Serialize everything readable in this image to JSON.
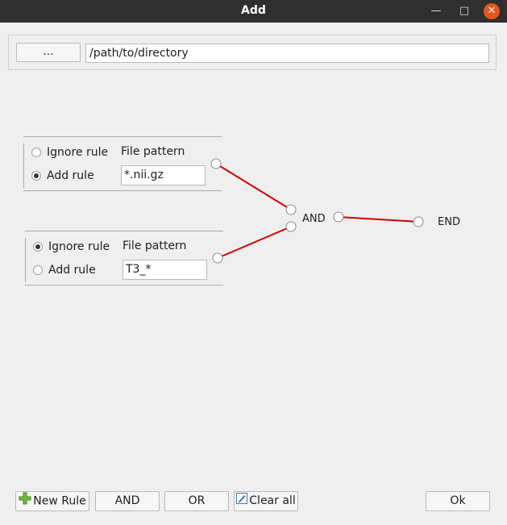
{
  "window": {
    "title": "Add"
  },
  "path": {
    "browse_label": "...",
    "value": "/path/to/directory"
  },
  "rules": [
    {
      "ignore_label": "Ignore rule",
      "add_label": "Add rule",
      "pattern_label": "File pattern",
      "pattern_value": "*.nii.gz",
      "selected": "add"
    },
    {
      "ignore_label": "Ignore rule",
      "add_label": "Add rule",
      "pattern_label": "File pattern",
      "pattern_value": "T3_*",
      "selected": "ignore"
    }
  ],
  "graph": {
    "and_label": "AND",
    "end_label": "END",
    "wire_color": "#d40000"
  },
  "buttons": {
    "new_rule": "New Rule",
    "and": "AND",
    "or": "OR",
    "clear_all": "Clear all",
    "ok": "Ok"
  },
  "icons": {
    "new_rule": "green-plus-icon",
    "clear_all": "edit-clear-icon"
  }
}
